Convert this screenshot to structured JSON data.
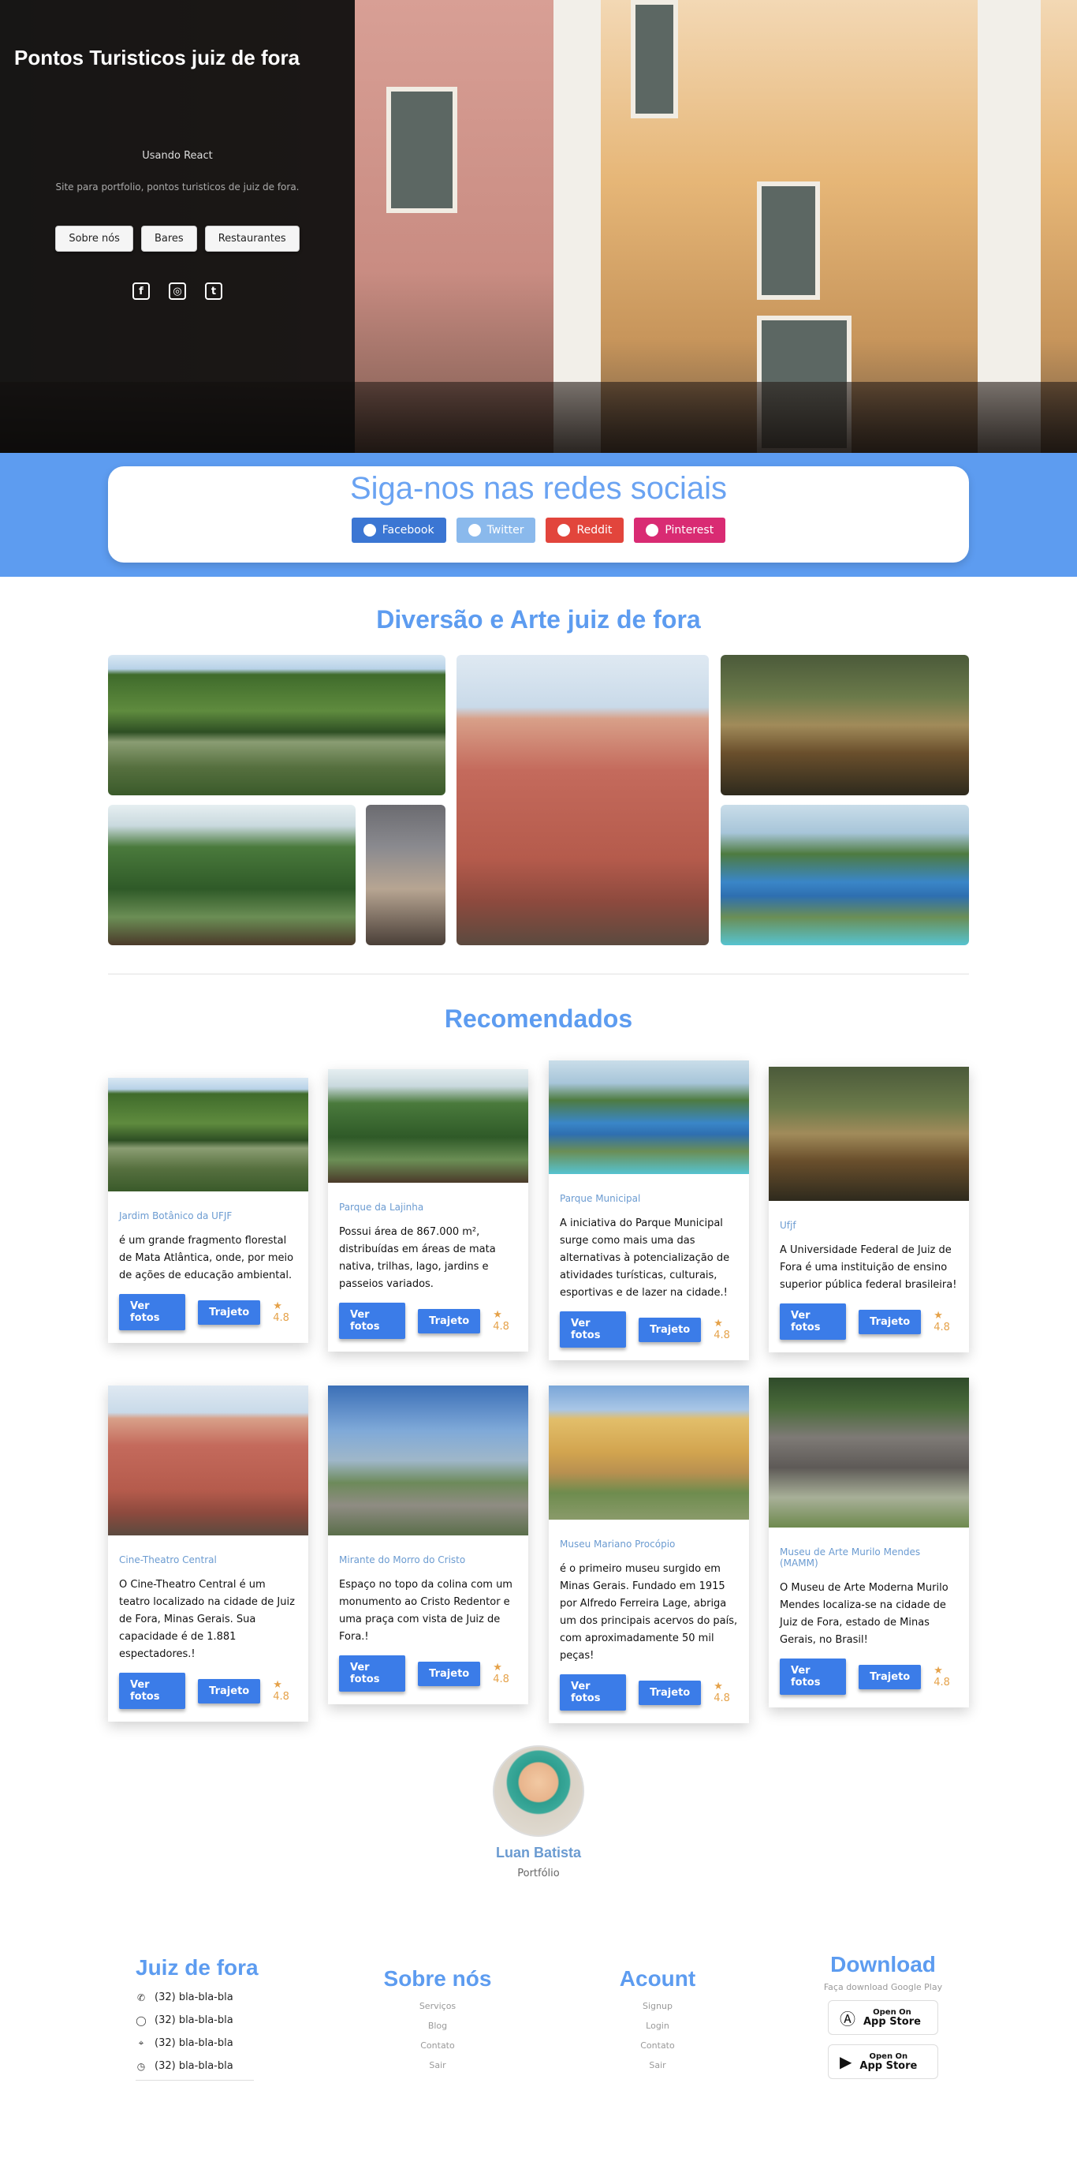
{
  "hero": {
    "title": "Pontos Turisticos juiz de fora",
    "subtitle": "Usando React",
    "description": "Site para portfolio, pontos turisticos de juiz de fora.",
    "buttons": [
      "Sobre nós",
      "Bares",
      "Restaurantes"
    ],
    "social_icons": [
      "facebook-icon",
      "instagram-icon",
      "twitter-icon"
    ]
  },
  "social_share": {
    "title": "Siga-nos nas redes sociais",
    "buttons": [
      {
        "label": "Facebook",
        "color": "#3b76d3"
      },
      {
        "label": "Twitter",
        "color": "#8ab9ec"
      },
      {
        "label": "Reddit",
        "color": "#e2453c"
      },
      {
        "label": "Pinterest",
        "color": "#d92b73"
      }
    ]
  },
  "gallery": {
    "title": "Diversão e Arte juiz de fora"
  },
  "recommended": {
    "title": "Recomendados",
    "cards": [
      {
        "category": "Jardim Botânico da UFJF",
        "description": "é um grande fragmento florestal de Mata Atlântica, onde, por meio de ações de educação ambiental.",
        "btn_photos": "Ver fotos",
        "btn_route": "Trajeto",
        "rating": "4.8"
      },
      {
        "category": "Parque da Lajinha",
        "description": "Possui área de 867.000 m², distribuídas em áreas de mata nativa, trilhas, lago, jardins e passeios variados.",
        "btn_photos": "Ver fotos",
        "btn_route": "Trajeto",
        "rating": "4.8"
      },
      {
        "category": "Parque Municipal",
        "description": "A iniciativa do Parque Municipal surge como mais uma das alternativas à potencialização de atividades turísticas, culturais, esportivas e de lazer na cidade.!",
        "btn_photos": "Ver fotos",
        "btn_route": "Trajeto",
        "rating": "4.8"
      },
      {
        "category": "Ufjf",
        "description": "A Universidade Federal de Juiz de Fora é uma instituição de ensino superior pública federal brasileira!",
        "btn_photos": "Ver fotos",
        "btn_route": "Trajeto",
        "rating": "4.8"
      },
      {
        "category": "Cine-Theatro Central",
        "description": "O Cine-Theatro Central é um teatro localizado na cidade de Juiz de Fora, Minas Gerais. Sua capacidade é de 1.881 espectadores.!",
        "btn_photos": "Ver fotos",
        "btn_route": "Trajeto",
        "rating": "4.8"
      },
      {
        "category": "Mirante do Morro do Cristo",
        "description": "Espaço no topo da colina com um monumento ao Cristo Redentor e uma praça com vista de Juiz de Fora.!",
        "btn_photos": "Ver fotos",
        "btn_route": "Trajeto",
        "rating": "4.8"
      },
      {
        "category": "Museu Mariano Procópio",
        "description": "é o primeiro museu surgido em Minas Gerais. Fundado em 1915 por Alfredo Ferreira Lage, abriga um dos principais acervos do país, com aproximadamente 50 mil peças!",
        "btn_photos": "Ver fotos",
        "btn_route": "Trajeto",
        "rating": "4.8"
      },
      {
        "category": "Museu de Arte Murilo Mendes (MAMM)",
        "description": "O Museu de Arte Moderna Murilo Mendes localiza-se na cidade de Juiz de Fora, estado de Minas Gerais, no Brasil!",
        "btn_photos": "Ver fotos",
        "btn_route": "Trajeto",
        "rating": "4.8"
      }
    ]
  },
  "profile": {
    "name": "Luan Batista",
    "role": "Portfólio"
  },
  "footer": {
    "col1": {
      "title": "Juiz de fora",
      "contacts": [
        "(32) bla-bla-bla",
        "(32) bla-bla-bla",
        "(32) bla-bla-bla",
        "(32) bla-bla-bla"
      ]
    },
    "col2": {
      "title": "Sobre nós",
      "links": [
        "Serviços",
        "Blog",
        "Contato",
        "Sair"
      ]
    },
    "col3": {
      "title": "Acount",
      "links": [
        "Signup",
        "Login",
        "Contato",
        "Sair"
      ]
    },
    "col4": {
      "title": "Download",
      "subtitle": "Faça download Google Play",
      "stores": [
        {
          "top": "Open On",
          "name": "App Store"
        },
        {
          "top": "Open On",
          "name": "App Store"
        }
      ]
    }
  }
}
